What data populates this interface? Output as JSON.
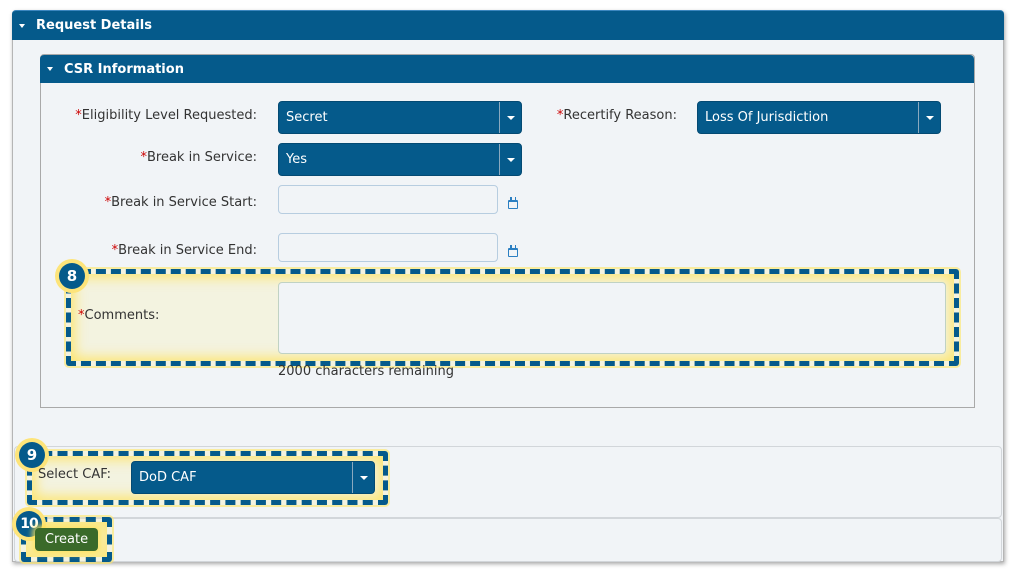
{
  "request_details": {
    "title": "Request Details",
    "csr_information": {
      "title": "CSR Information",
      "fields": {
        "eligibility_level": {
          "required_mark": "*",
          "label": "Eligibility Level Requested:",
          "value": "Secret"
        },
        "recertify_reason": {
          "required_mark": "*",
          "label": "Recertify Reason:",
          "value": "Loss Of Jurisdiction"
        },
        "break_in_service": {
          "required_mark": "*",
          "label": "Break in Service:",
          "value": "Yes"
        },
        "break_start": {
          "required_mark": "*",
          "label": "Break in Service Start:",
          "value": "",
          "icon": "calendar-icon"
        },
        "break_end": {
          "required_mark": "*",
          "label": "Break in Service End:",
          "value": "",
          "icon": "calendar-icon"
        },
        "comments": {
          "required_mark": "*",
          "label": "Comments:",
          "value": "",
          "chars_remaining": "2000 characters remaining"
        }
      }
    }
  },
  "select_caf": {
    "label": "Select CAF:",
    "value": "DoD CAF"
  },
  "actions": {
    "create_label": "Create"
  },
  "annotations": {
    "comments_step": "8",
    "caf_step": "9",
    "create_step": "10",
    "highlight_color": "#fde47a",
    "dash_color": "#055a8b"
  },
  "colors": {
    "header_bg": "#055a8b",
    "button_green": "#3a6a2a",
    "required": "#cc0000",
    "panel_bg": "#f1f4f7"
  }
}
